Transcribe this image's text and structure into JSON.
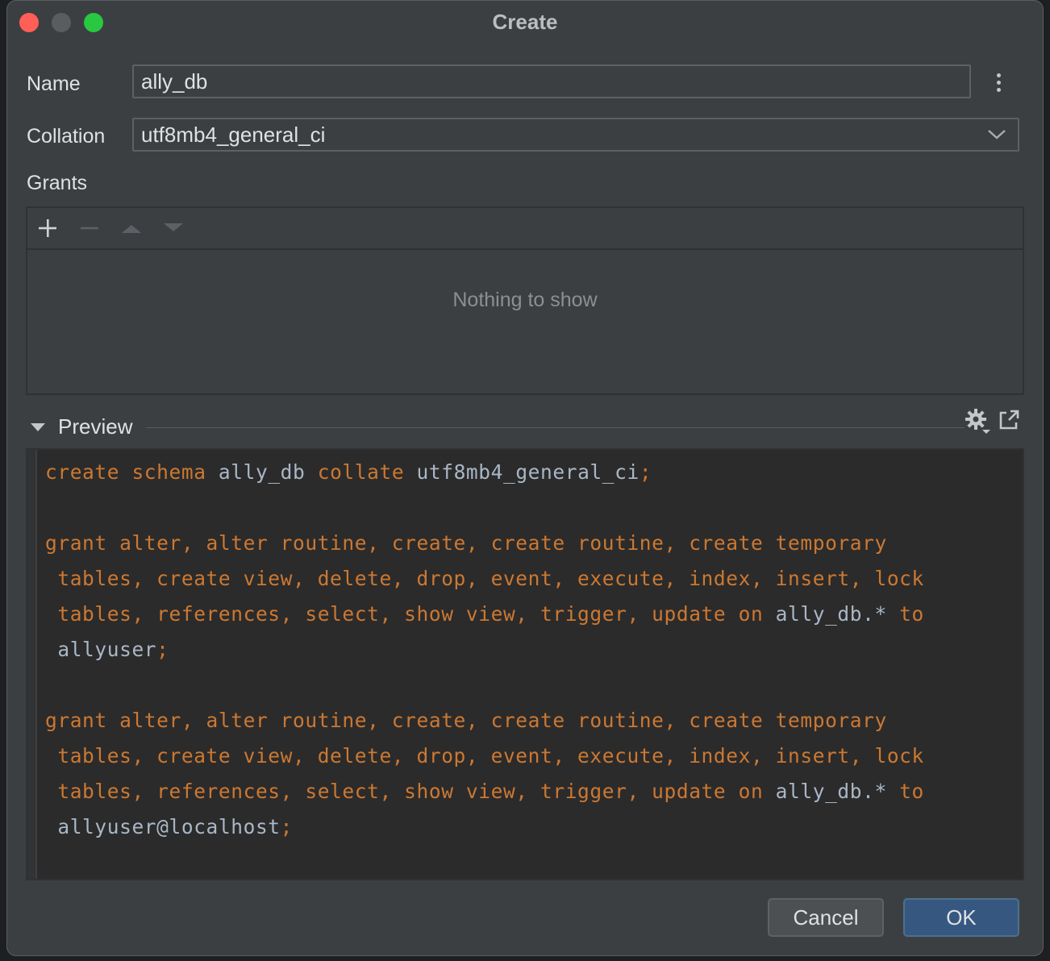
{
  "window": {
    "title": "Create"
  },
  "form": {
    "name_label": "Name",
    "name_value": "ally_db",
    "collation_label": "Collation",
    "collation_value": "utf8mb4_general_ci",
    "grants_label": "Grants"
  },
  "grants": {
    "toolbar": [
      "add-icon",
      "remove-icon",
      "move-up-icon",
      "move-down-icon"
    ],
    "empty_text": "Nothing to show"
  },
  "preview": {
    "label": "Preview",
    "code_lines": [
      [
        [
          "create schema ",
          "kw"
        ],
        [
          "ally_db ",
          "id"
        ],
        [
          "collate ",
          "kw"
        ],
        [
          "utf8mb4_general_ci",
          "id"
        ],
        [
          ";",
          "kw"
        ]
      ],
      [],
      [
        [
          "grant alter, alter routine, create, create routine, create temporary",
          "kw"
        ]
      ],
      [
        [
          " tables, create view, delete, drop, event, execute, index, insert, lock",
          "kw"
        ]
      ],
      [
        [
          " tables, references, select, show view, trigger, update on ",
          "kw"
        ],
        [
          "ally_db.* ",
          "id"
        ],
        [
          "to",
          "kw"
        ]
      ],
      [
        [
          " allyuser",
          "id"
        ],
        [
          ";",
          "kw"
        ]
      ],
      [],
      [
        [
          "grant alter, alter routine, create, create routine, create temporary",
          "kw"
        ]
      ],
      [
        [
          " tables, create view, delete, drop, event, execute, index, insert, lock",
          "kw"
        ]
      ],
      [
        [
          " tables, references, select, show view, trigger, update on ",
          "kw"
        ],
        [
          "ally_db.* ",
          "id"
        ],
        [
          "to",
          "kw"
        ]
      ],
      [
        [
          " allyuser@localhost",
          "id"
        ],
        [
          ";",
          "kw"
        ]
      ]
    ]
  },
  "buttons": {
    "cancel": "Cancel",
    "ok": "OK"
  },
  "colors": {
    "keyword": "#cc7832",
    "identifier": "#a9b7c6",
    "accent": "#365880"
  }
}
